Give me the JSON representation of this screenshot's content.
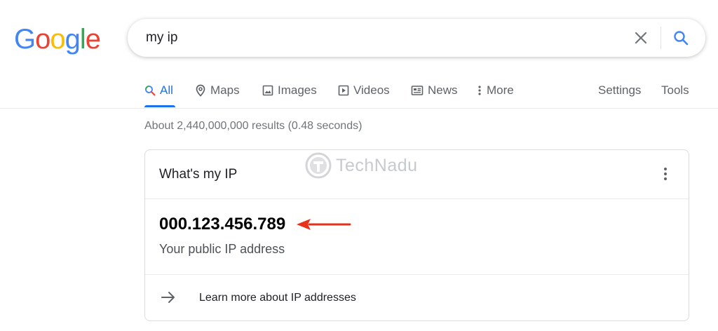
{
  "logo": {
    "letters": [
      "G",
      "o",
      "o",
      "g",
      "l",
      "e"
    ],
    "colors": [
      "#4285F4",
      "#EA4335",
      "#FBBC05",
      "#4285F4",
      "#34A853",
      "#EA4335"
    ]
  },
  "search": {
    "query": "my ip",
    "clear_icon": "close-icon",
    "search_icon": "search-icon"
  },
  "tabs": [
    {
      "label": "All",
      "icon": "search-icon",
      "active": true
    },
    {
      "label": "Maps",
      "icon": "map-pin-icon",
      "active": false
    },
    {
      "label": "Images",
      "icon": "image-icon",
      "active": false
    },
    {
      "label": "Videos",
      "icon": "play-icon",
      "active": false
    },
    {
      "label": "News",
      "icon": "newspaper-icon",
      "active": false
    },
    {
      "label": "More",
      "icon": "more-vertical-icon",
      "active": false
    }
  ],
  "tools": {
    "settings": "Settings",
    "tools": "Tools"
  },
  "result_stats": "About 2,440,000,000 results (0.48 seconds)",
  "card": {
    "title": "What's my IP",
    "ip_value": "000.123.456.789",
    "ip_caption": "Your public IP address",
    "learn_more": "Learn more about IP addresses",
    "menu_icon": "more-vertical-icon"
  },
  "watermark": {
    "text": "TechNadu"
  },
  "colors": {
    "accent": "#1a73e8",
    "annotation_arrow": "#e8311b"
  }
}
